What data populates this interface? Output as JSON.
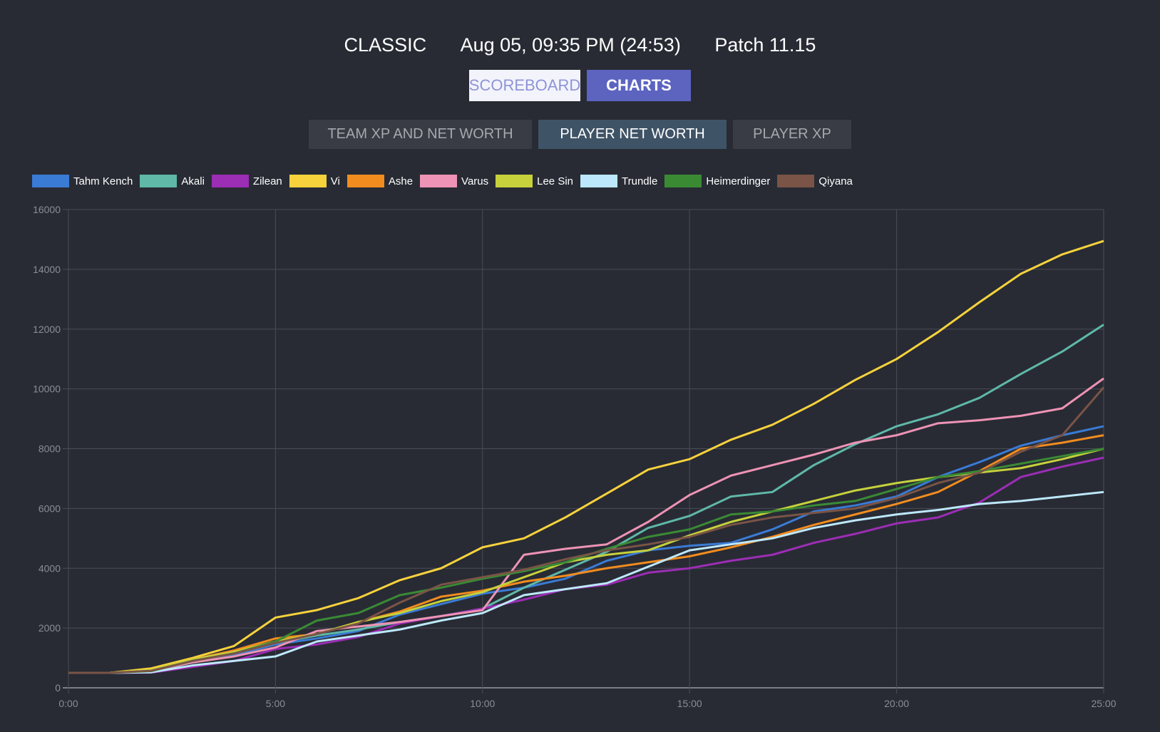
{
  "header": {
    "mode": "CLASSIC",
    "date": "Aug 05, 09:35 PM (24:53)",
    "patch": "Patch 11.15"
  },
  "view_tabs": [
    {
      "label": "SCOREBOARD",
      "active": false
    },
    {
      "label": "CHARTS",
      "active": true
    }
  ],
  "sub_tabs": [
    {
      "label": "TEAM XP AND NET WORTH",
      "active": false
    },
    {
      "label": "PLAYER NET WORTH",
      "active": true
    },
    {
      "label": "PLAYER XP",
      "active": false
    }
  ],
  "colors": {
    "background": "#282b34",
    "grid": "#4a4d55",
    "tick_label": "#8a8d94",
    "active_tab": "#5c64c0",
    "active_subtab": "#3f5366"
  },
  "chart_data": {
    "type": "line",
    "title": "",
    "xlabel": "",
    "ylabel": "",
    "x_ticks": [
      "0:00",
      "5:00",
      "10:00",
      "15:00",
      "20:00",
      "25:00"
    ],
    "y_ticks": [
      "0",
      "2000",
      "4000",
      "6000",
      "8000",
      "10000",
      "12000",
      "14000",
      "16000"
    ],
    "xlim": [
      0,
      25
    ],
    "ylim": [
      0,
      16000
    ],
    "grid": true,
    "legend_position": "top-left",
    "x": [
      0,
      1,
      2,
      3,
      4,
      5,
      6,
      7,
      8,
      9,
      10,
      11,
      12,
      13,
      14,
      15,
      16,
      17,
      18,
      19,
      20,
      21,
      22,
      23,
      24,
      25
    ],
    "series": [
      {
        "name": "Tahm Kench",
        "color": "#3a7bd5",
        "values": [
          500,
          500,
          560,
          850,
          1100,
          1450,
          1650,
          1900,
          2450,
          2800,
          3150,
          3350,
          3650,
          4250,
          4600,
          4750,
          4850,
          5300,
          5900,
          6100,
          6400,
          7050,
          7550,
          8100,
          8450,
          8750
        ]
      },
      {
        "name": "Akali",
        "color": "#5fb8a8",
        "values": [
          500,
          500,
          580,
          900,
          1150,
          1500,
          1750,
          1950,
          2200,
          2400,
          2650,
          3350,
          3950,
          4550,
          5350,
          5750,
          6400,
          6550,
          7450,
          8150,
          8750,
          9150,
          9700,
          10500,
          11250,
          12150
        ]
      },
      {
        "name": "Zilean",
        "color": "#9c2db5",
        "values": [
          500,
          500,
          510,
          700,
          900,
          1300,
          1450,
          1700,
          2150,
          2400,
          2650,
          2950,
          3300,
          3450,
          3850,
          4000,
          4250,
          4450,
          4850,
          5150,
          5500,
          5700,
          6200,
          7050,
          7400,
          7700
        ]
      },
      {
        "name": "Vi",
        "color": "#f8d23c",
        "values": [
          500,
          500,
          650,
          1000,
          1400,
          2350,
          2600,
          3000,
          3600,
          4000,
          4700,
          5000,
          5700,
          6500,
          7300,
          7650,
          8300,
          8800,
          9500,
          10300,
          11000,
          11900,
          12900,
          13850,
          14500,
          14950
        ]
      },
      {
        "name": "Ashe",
        "color": "#f28c1e",
        "values": [
          500,
          500,
          600,
          950,
          1250,
          1650,
          1800,
          2200,
          2550,
          3050,
          3250,
          3550,
          3750,
          4000,
          4200,
          4400,
          4700,
          5050,
          5450,
          5800,
          6150,
          6550,
          7250,
          8000,
          8200,
          8450
        ]
      },
      {
        "name": "Varus",
        "color": "#ee93b5",
        "values": [
          500,
          500,
          560,
          850,
          1050,
          1350,
          1900,
          2050,
          2200,
          2400,
          2600,
          4450,
          4650,
          4800,
          5550,
          6450,
          7100,
          7450,
          7800,
          8200,
          8450,
          8850,
          8950,
          9100,
          9350,
          10350
        ]
      },
      {
        "name": "Lee Sin",
        "color": "#c6d13c",
        "values": [
          500,
          500,
          600,
          950,
          1200,
          1550,
          1800,
          2200,
          2500,
          2900,
          3200,
          3700,
          4200,
          4450,
          4600,
          5100,
          5550,
          5900,
          6250,
          6600,
          6850,
          7050,
          7200,
          7350,
          7650,
          8000
        ]
      },
      {
        "name": "Trundle",
        "color": "#bde8fb",
        "values": [
          500,
          500,
          520,
          750,
          900,
          1050,
          1550,
          1750,
          1950,
          2250,
          2500,
          3100,
          3300,
          3500,
          4050,
          4600,
          4800,
          5000,
          5350,
          5600,
          5800,
          5950,
          6150,
          6250,
          6400,
          6550
        ]
      },
      {
        "name": "Heimerdinger",
        "color": "#3a8a34",
        "values": [
          500,
          500,
          560,
          900,
          1150,
          1550,
          2250,
          2500,
          3100,
          3350,
          3650,
          3900,
          4200,
          4650,
          5050,
          5300,
          5800,
          5900,
          6100,
          6250,
          6650,
          7050,
          7250,
          7500,
          7750,
          8000
        ]
      },
      {
        "name": "Qiyana",
        "color": "#7a5446",
        "values": [
          500,
          500,
          570,
          900,
          1150,
          1500,
          1800,
          2150,
          2850,
          3450,
          3700,
          3950,
          4300,
          4600,
          4800,
          5050,
          5450,
          5700,
          5850,
          6000,
          6350,
          6850,
          7200,
          7900,
          8450,
          10050
        ]
      }
    ]
  }
}
